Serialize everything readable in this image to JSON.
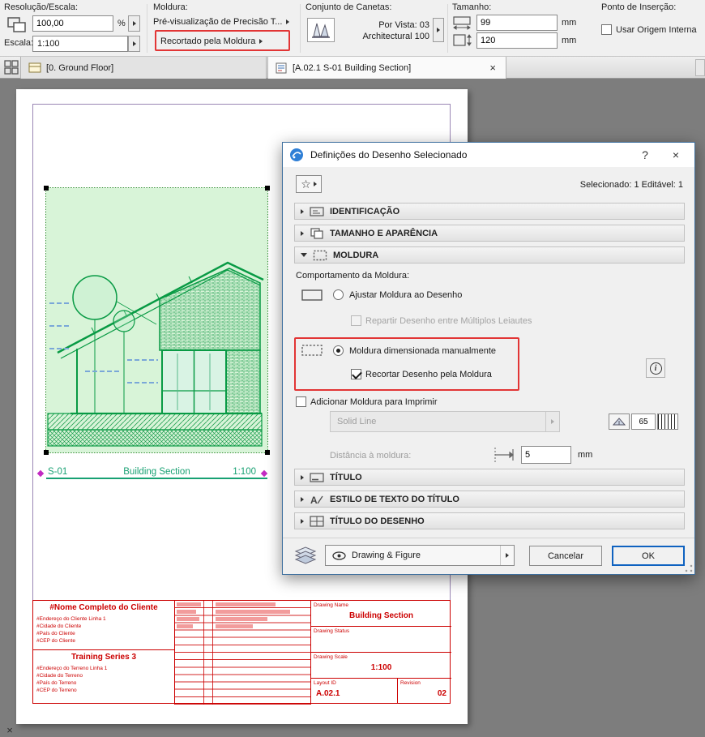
{
  "window": {
    "pane_close_label": "×"
  },
  "toolbar": {
    "resolution_group": {
      "label": "Resolução/Escala:",
      "resolution_value": "100,00",
      "percent_label": "%",
      "scale_label": "Escala:",
      "scale_value": "1:100"
    },
    "moldura_group": {
      "label": "Moldura:",
      "preview_value": "Pré-visualização de Precisão T...",
      "crop_value": "Recortado pela Moldura"
    },
    "pens_group": {
      "label": "Conjunto de Canetas:",
      "value_line1": "Por Vista: 03",
      "value_line2": "Architectural 100"
    },
    "size_group": {
      "label": "Tamanho:",
      "width_value": "99",
      "height_value": "120",
      "unit": "mm"
    },
    "insertion_group": {
      "label": "Ponto de Inserção:",
      "checkbox_label": "Usar Origem Interna"
    }
  },
  "tabs": {
    "ground_floor": "[0. Ground Floor]",
    "section": "[A.02.1 S-01 Building Section]",
    "close_label": "×"
  },
  "layout": {
    "drawing_title": {
      "id": "S-01",
      "name": "Building Section",
      "scale": "1:100"
    },
    "titleblock": {
      "client_name": "#Nome Completo do Cliente",
      "client_lines": [
        "#Endereço do Cliente Linha 1",
        "#Cidade do Cliente",
        "#País do Cliente",
        "#CEP do Cliente"
      ],
      "project_name": "Training Series 3",
      "site_lines": [
        "#Endereço do Terreno Linha 1",
        "#Cidade do Terreno",
        "#País do Terreno",
        "#CEP do Terreno"
      ],
      "drawing_name_label": "Drawing Name",
      "drawing_name_value": "Building Section",
      "drawing_status_label": "Drawing Status",
      "drawing_scale_label": "Drawing Scale",
      "drawing_scale_value": "1:100",
      "layout_id_label": "Layout ID",
      "layout_id_value": "A.02.1",
      "revision_label": "Revision",
      "revision_value": "02"
    }
  },
  "dialog": {
    "title": "Definições do Desenho Selecionado",
    "help_label": "?",
    "close_label": "×",
    "selection_info": "Selecionado: 1 Editável: 1",
    "sections": {
      "identification": "IDENTIFICAÇÃO",
      "size_appearance": "TAMANHO E APARÊNCIA",
      "frame": "MOLDURA",
      "title": "TÍTULO",
      "title_text_style": "ESTILO DE TEXTO DO TÍTULO",
      "drawing_title": "TÍTULO DO DESENHO"
    },
    "frame_panel": {
      "behavior_label": "Comportamento da Moldura:",
      "fit_frame_option": "Ajustar Moldura ao Desenho",
      "split_option": "Repartir Desenho entre Múltiplos Leiautes",
      "manual_frame_option": "Moldura dimensionada manualmente",
      "crop_option": "Recortar Desenho pela Moldura",
      "printed_frame_option": "Adicionar Moldura para Imprimir",
      "line_type_value": "Solid Line",
      "pen_value": "65",
      "distance_label": "Distância à moldura:",
      "distance_value": "5",
      "distance_unit": "mm"
    },
    "footer": {
      "layer_value": "Drawing & Figure",
      "cancel_label": "Cancelar",
      "ok_label": "OK"
    }
  },
  "colors": {
    "highlight_red": "#e23535",
    "drawing_green": "#089a44",
    "title_teal": "#18a173",
    "titleblock_red": "#cc0000",
    "ok_border_blue": "#0f62c0"
  }
}
